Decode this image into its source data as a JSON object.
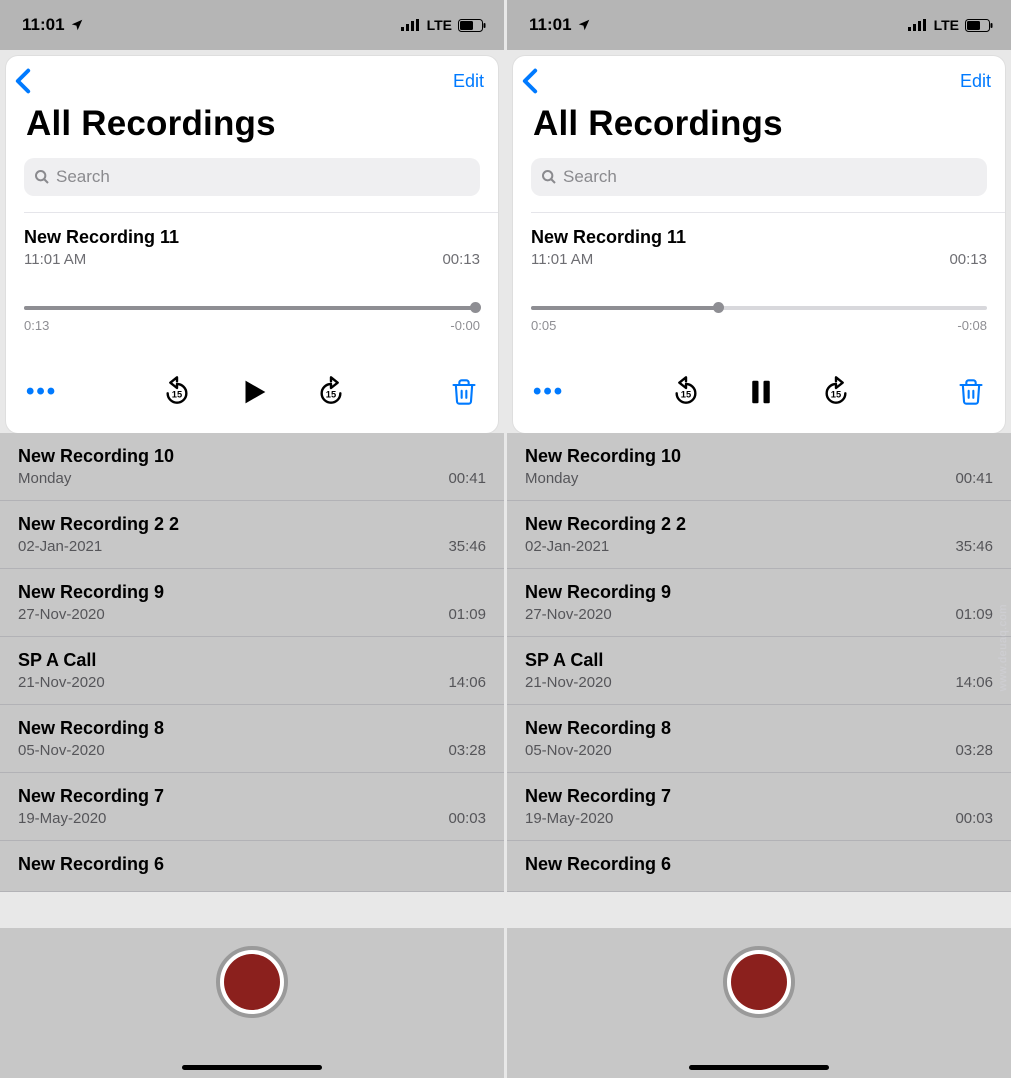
{
  "status": {
    "time": "11:01",
    "carrier": "LTE"
  },
  "nav": {
    "edit": "Edit"
  },
  "title": "All Recordings",
  "search": {
    "placeholder": "Search"
  },
  "expanded": {
    "title": "New Recording 11",
    "time": "11:01 AM",
    "duration": "00:13"
  },
  "left": {
    "scrub": {
      "elapsed": "0:13",
      "remaining": "-0:00",
      "fill_pct": 100,
      "thumb_pct": 99
    },
    "play_state": "play"
  },
  "right": {
    "scrub": {
      "elapsed": "0:05",
      "remaining": "-0:08",
      "fill_pct": 41,
      "thumb_pct": 41
    },
    "play_state": "pause"
  },
  "recordings": [
    {
      "title": "New Recording 10",
      "date": "Monday",
      "dur": "00:41"
    },
    {
      "title": "New Recording 2 2",
      "date": "02-Jan-2021",
      "dur": "35:46"
    },
    {
      "title": "New Recording 9",
      "date": "27-Nov-2020",
      "dur": "01:09"
    },
    {
      "title": "SP A Call",
      "date": "21-Nov-2020",
      "dur": "14:06"
    },
    {
      "title": "New Recording 8",
      "date": "05-Nov-2020",
      "dur": "03:28"
    },
    {
      "title": "New Recording 7",
      "date": "19-May-2020",
      "dur": "00:03"
    },
    {
      "title": "New Recording 6",
      "date": "",
      "dur": ""
    }
  ],
  "watermark": "www.deuaq.com"
}
